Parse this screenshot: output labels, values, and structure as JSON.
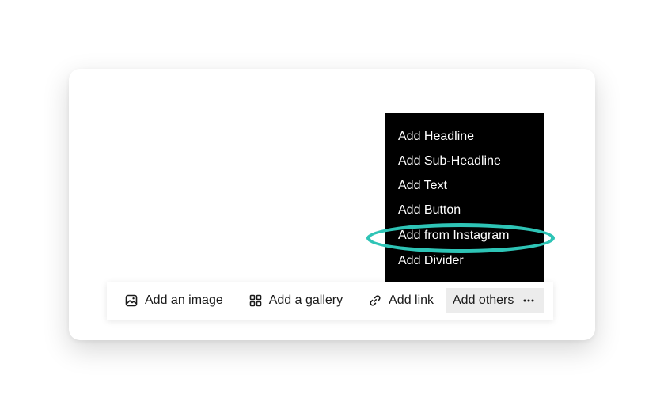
{
  "menu": {
    "items": [
      {
        "label": "Add Headline"
      },
      {
        "label": "Add Sub-Headline"
      },
      {
        "label": "Add Text"
      },
      {
        "label": "Add Button"
      },
      {
        "label": "Add from Instagram",
        "highlighted": true
      },
      {
        "label": "Add Divider"
      }
    ]
  },
  "toolbar": {
    "image_label": "Add an image",
    "gallery_label": "Add a gallery",
    "link_label": "Add link",
    "others_label": "Add others"
  },
  "icons": {
    "image": "image-icon",
    "gallery": "gallery-grid-icon",
    "link": "link-icon",
    "more": "more-horizontal-icon"
  },
  "colors": {
    "menu_background": "#000000",
    "menu_text": "#ffffff",
    "highlight_ring": "#2ec4b6",
    "others_button_background": "#ececec"
  }
}
